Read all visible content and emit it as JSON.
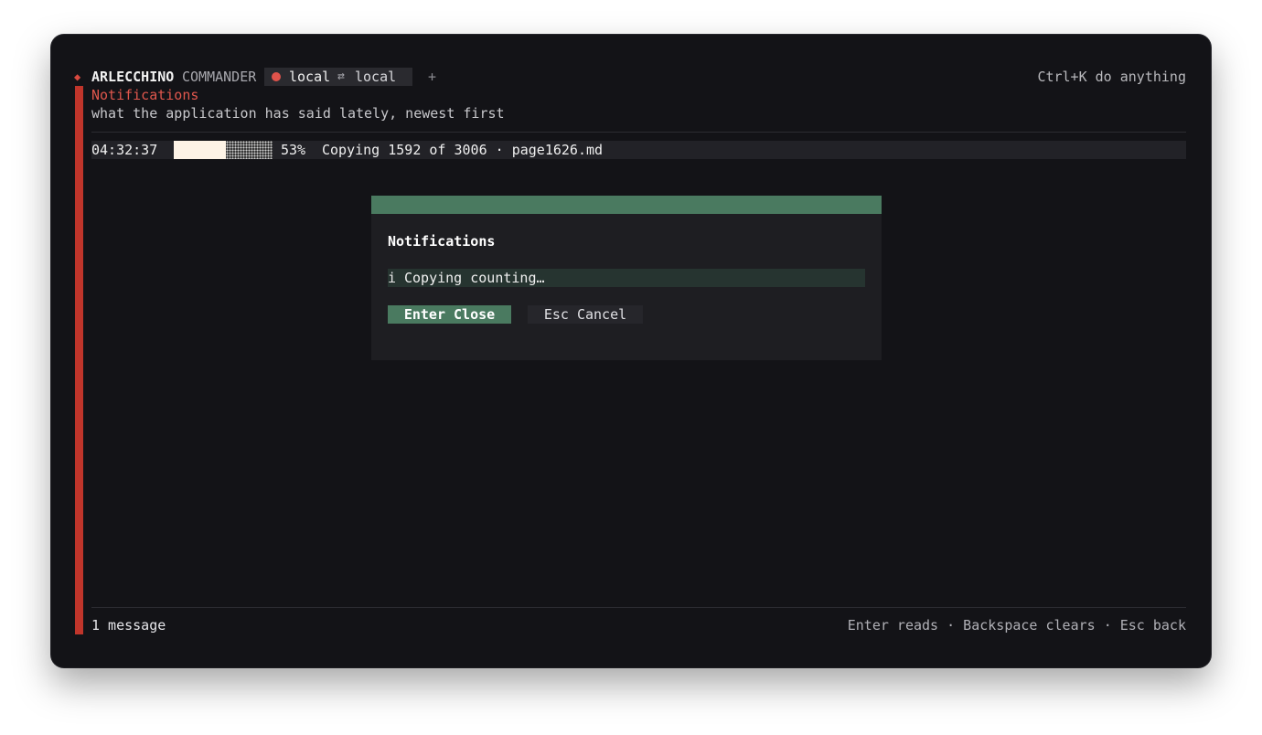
{
  "app": {
    "brand_primary": "ARLECCHINO",
    "brand_secondary": "COMMANDER",
    "tab": {
      "source": "local",
      "arrow": "⇄",
      "destination": "local",
      "dot_color": "#e0534b"
    },
    "new_tab": "+",
    "hint": "Ctrl+K do anything"
  },
  "page": {
    "title": "Notifications",
    "subtitle": "what the application has said lately, newest first"
  },
  "notifications": [
    {
      "time": "04:32:37",
      "progress": 0.53,
      "percent": "53%",
      "message": "Copying 1592 of 3006 · page1626.md"
    }
  ],
  "dialog": {
    "title": "Notifications",
    "item_icon": "i",
    "item_text": "Copying counting…",
    "primary_button": "Enter Close",
    "secondary_button": "Esc Cancel"
  },
  "footer": {
    "count": "1 message",
    "keys": "Enter reads · Backspace clears · Esc back"
  },
  "colors": {
    "accent": "#c0352b",
    "title": "#e0574d",
    "dialog_header": "#4a7a60",
    "background": "#131317"
  }
}
